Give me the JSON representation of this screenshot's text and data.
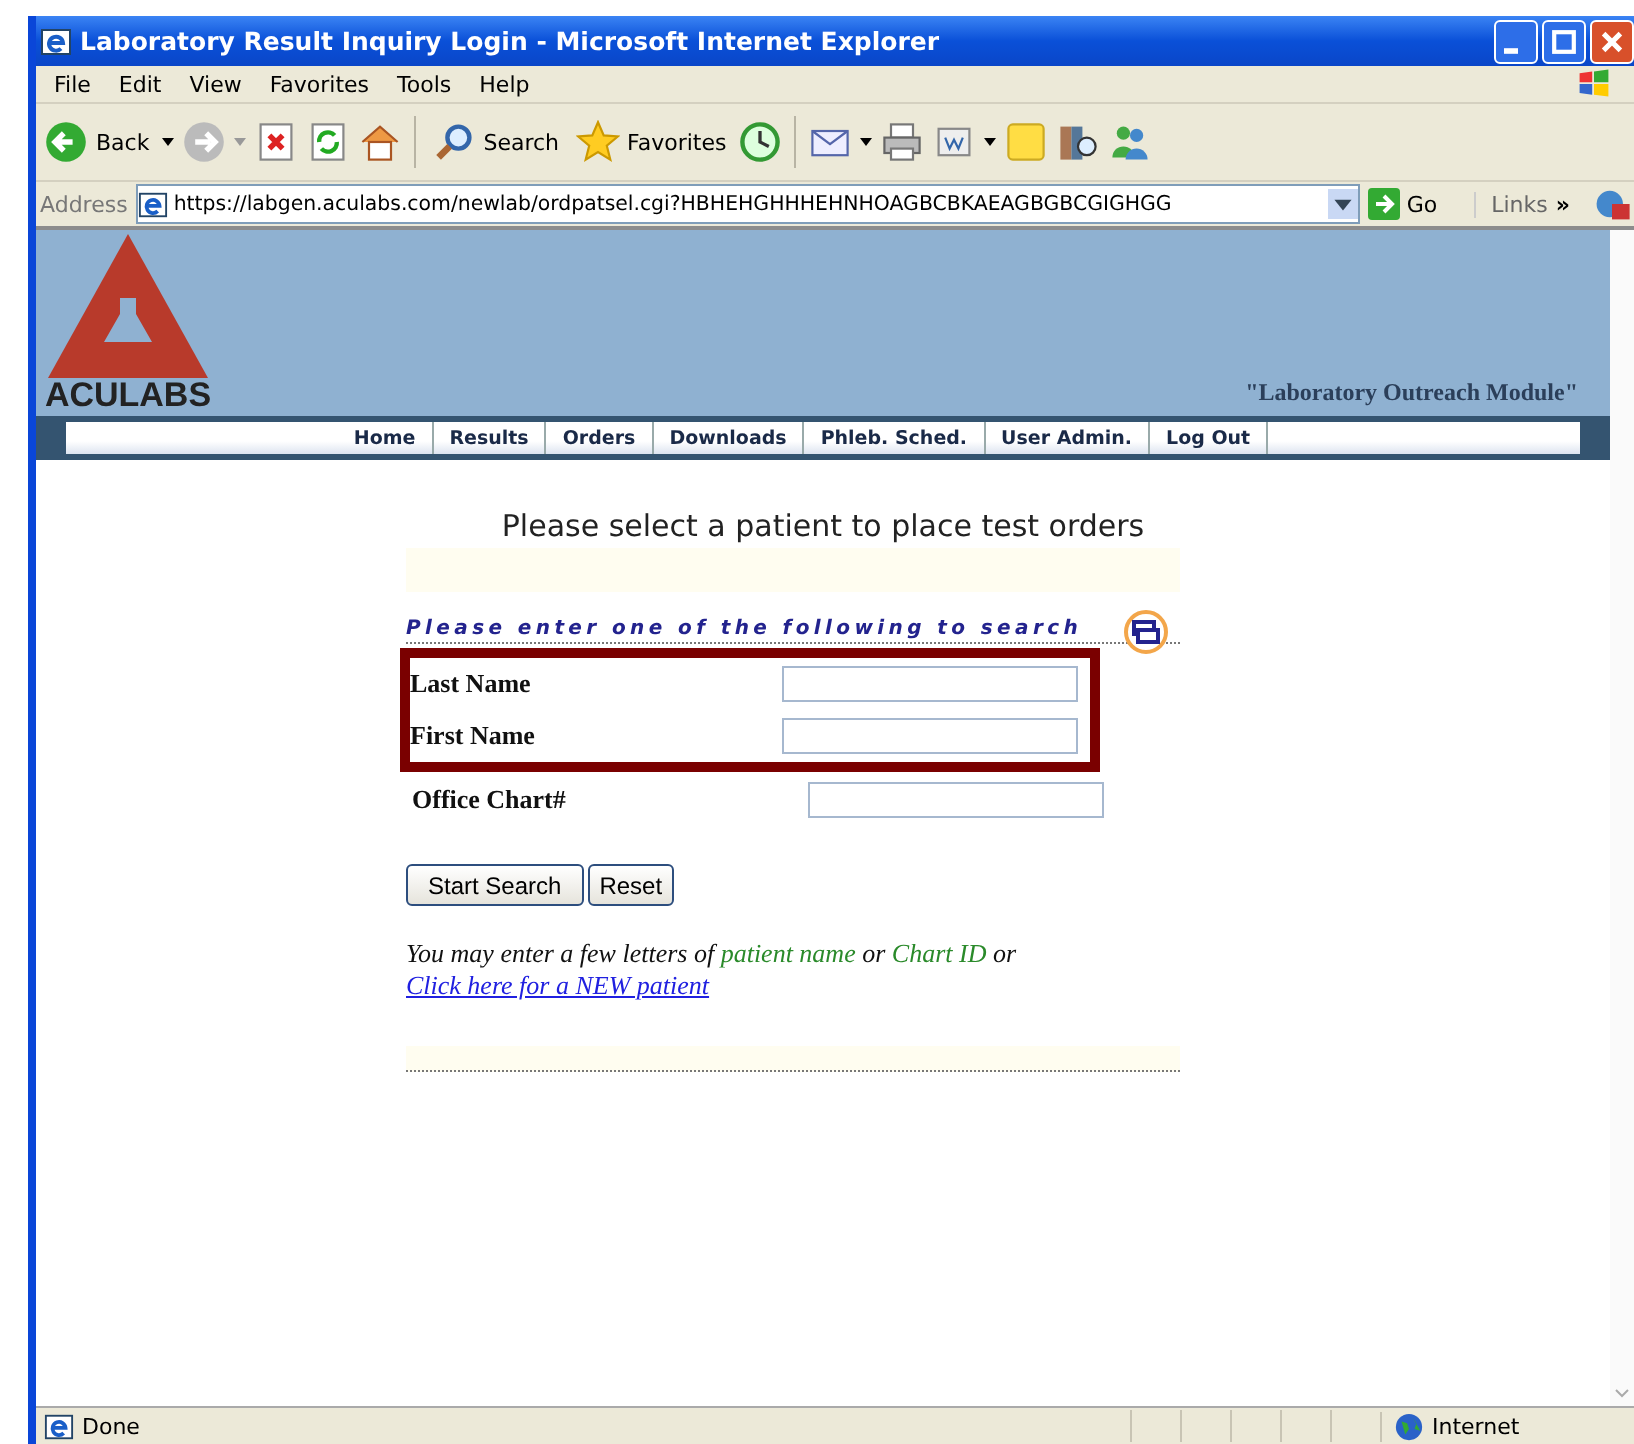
{
  "window": {
    "title": "Laboratory Result Inquiry Login - Microsoft Internet Explorer"
  },
  "menu": [
    "File",
    "Edit",
    "View",
    "Favorites",
    "Tools",
    "Help"
  ],
  "toolbar": {
    "back": "Back",
    "search": "Search",
    "favorites": "Favorites"
  },
  "address": {
    "label": "Address",
    "url": "https://labgen.aculabs.com/newlab/ordpatsel.cgi?HBHEHGHHHEHNHOAGBCBKAEAGBGBCGIGHGG",
    "go": "Go",
    "links": "Links",
    "more": "»"
  },
  "header": {
    "logo": "ACULABS",
    "tagline": "\"Laboratory Outreach Module\""
  },
  "nav": [
    "Home",
    "Results",
    "Orders",
    "Downloads",
    "Phleb. Sched.",
    "User Admin.",
    "Log Out"
  ],
  "heading": "Please select a patient to place test orders",
  "search": {
    "instruction": "Please enter one of the following to search",
    "fields": [
      {
        "label": "Last Name",
        "highlighted": true
      },
      {
        "label": "First Name",
        "highlighted": true
      },
      {
        "label": "Office Chart#",
        "highlighted": false
      }
    ],
    "buttons": [
      "Start Search",
      "Reset"
    ],
    "hint": [
      {
        "kind": "plain",
        "text": "You may enter a few letters of "
      },
      {
        "kind": "term",
        "text": "patient name"
      },
      {
        "kind": "plain",
        "text": " or "
      },
      {
        "kind": "term",
        "text": "Chart ID"
      },
      {
        "kind": "plain",
        "text": " or"
      }
    ],
    "new_patient_link": "Click here for a NEW patient"
  },
  "status_bar": {
    "text": "Done",
    "zone": "Internet"
  }
}
